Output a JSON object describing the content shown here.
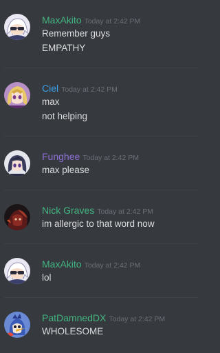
{
  "messages": [
    {
      "author": "MaxAkito",
      "color": "#43b581",
      "avatar": "anime-boy-sunglasses",
      "timestamp": "Today at 2:42 PM",
      "lines": [
        "Remember guys",
        "EMPATHY"
      ]
    },
    {
      "author": "Ciel",
      "color": "#3fa0e6",
      "avatar": "anime-girl-blonde",
      "timestamp": "Today at 2:42 PM",
      "lines": [
        "max",
        "not helping"
      ]
    },
    {
      "author": "Funghee",
      "color": "#8d6fd6",
      "avatar": "anime-girl-dark-hair",
      "timestamp": "Today at 2:42 PM",
      "lines": [
        "max please"
      ]
    },
    {
      "author": "Nick Graves",
      "color": "#43b581",
      "avatar": "dark-red-figure",
      "timestamp": "Today at 2:42 PM",
      "lines": [
        "im allergic to that word now"
      ]
    },
    {
      "author": "MaxAkito",
      "color": "#43b581",
      "avatar": "anime-boy-sunglasses",
      "timestamp": "Today at 2:42 PM",
      "lines": [
        "lol"
      ]
    },
    {
      "author": "PatDamnedDX",
      "color": "#43b581",
      "avatar": "cartoon-bird",
      "timestamp": "Today at 2:42 PM",
      "lines": [
        "WHOLESOME"
      ]
    }
  ]
}
